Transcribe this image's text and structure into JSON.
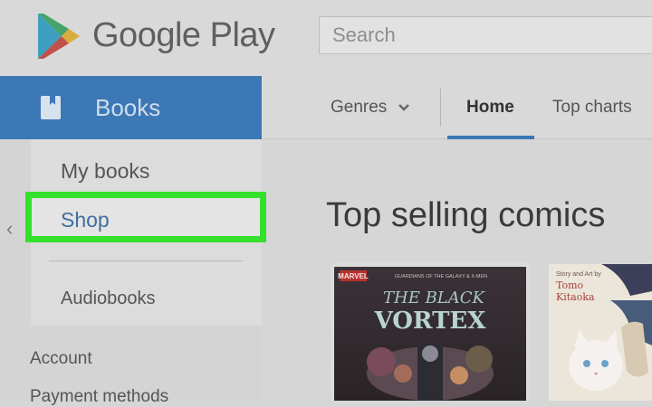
{
  "header": {
    "brand": "Google Play",
    "search_placeholder": "Search"
  },
  "sidebar": {
    "section_label": "Books",
    "items": [
      {
        "label": "My books"
      },
      {
        "label": "Shop"
      },
      {
        "label": "Audiobooks"
      }
    ],
    "account": "Account",
    "payment": "Payment methods"
  },
  "topnav": {
    "genres": "Genres",
    "home": "Home",
    "top_charts": "Top charts"
  },
  "main": {
    "section_title": "Top selling comics",
    "comics": [
      {
        "publisher": "MARVEL",
        "series": "GUARDIANS OF THE GALAXY & X-MEN",
        "title_line1": "THE BLACK",
        "title_line2": "VORTEX"
      },
      {
        "credit": "Story and Art by",
        "author_first": "Tomo",
        "author_last": "Kitaoka"
      }
    ]
  },
  "colors": {
    "accent_blue": "#3d78b6",
    "highlight_green": "#35e02d"
  }
}
